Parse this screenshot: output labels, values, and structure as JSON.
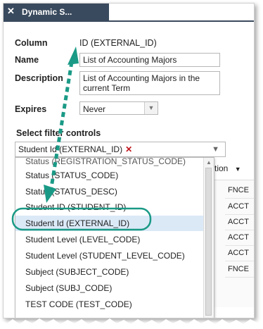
{
  "dialog": {
    "title": "Dynamic S...",
    "close_glyph": "✕"
  },
  "form": {
    "column_label": "Column",
    "column_value": "ID (EXTERNAL_ID)",
    "name_label": "Name",
    "name_value": "List of Accounting Majors",
    "description_label": "Description",
    "description_value_line1": "List of Accounting Majors in the",
    "description_value_line2": "current Term",
    "expires_label": "Expires",
    "expires_value": "Never",
    "filter_controls_label": "Select filter controls",
    "filter_chip_label": "Student Id (EXTERNAL_ID)",
    "filter_chip_remove": "✕"
  },
  "background": {
    "partial_header": "tion",
    "column_values": [
      "FNCE",
      "ACCT",
      "ACCT",
      "ACCT",
      "ACCT",
      "FNCE"
    ]
  },
  "dropdown": {
    "partial_top": "Status (REGISTRATION_STATUS_CODE)",
    "options": [
      "Status (STATUS_CODE)",
      "Status (STATUS_DESC)",
      "Student ID (STUDENT_ID)",
      "Student Id (EXTERNAL_ID)",
      "Student Level (LEVEL_CODE)",
      "Student Level (STUDENT_LEVEL_CODE)",
      "Subject (SUBJECT_CODE)",
      "Subject (SUBJ_CODE)",
      "TEST CODE (TEST_CODE)"
    ],
    "highlighted_index": 3
  },
  "colors": {
    "annotation_teal": "#1a9a86",
    "highlight_blue": "#dbe9f7",
    "remove_red": "#c0141c"
  }
}
